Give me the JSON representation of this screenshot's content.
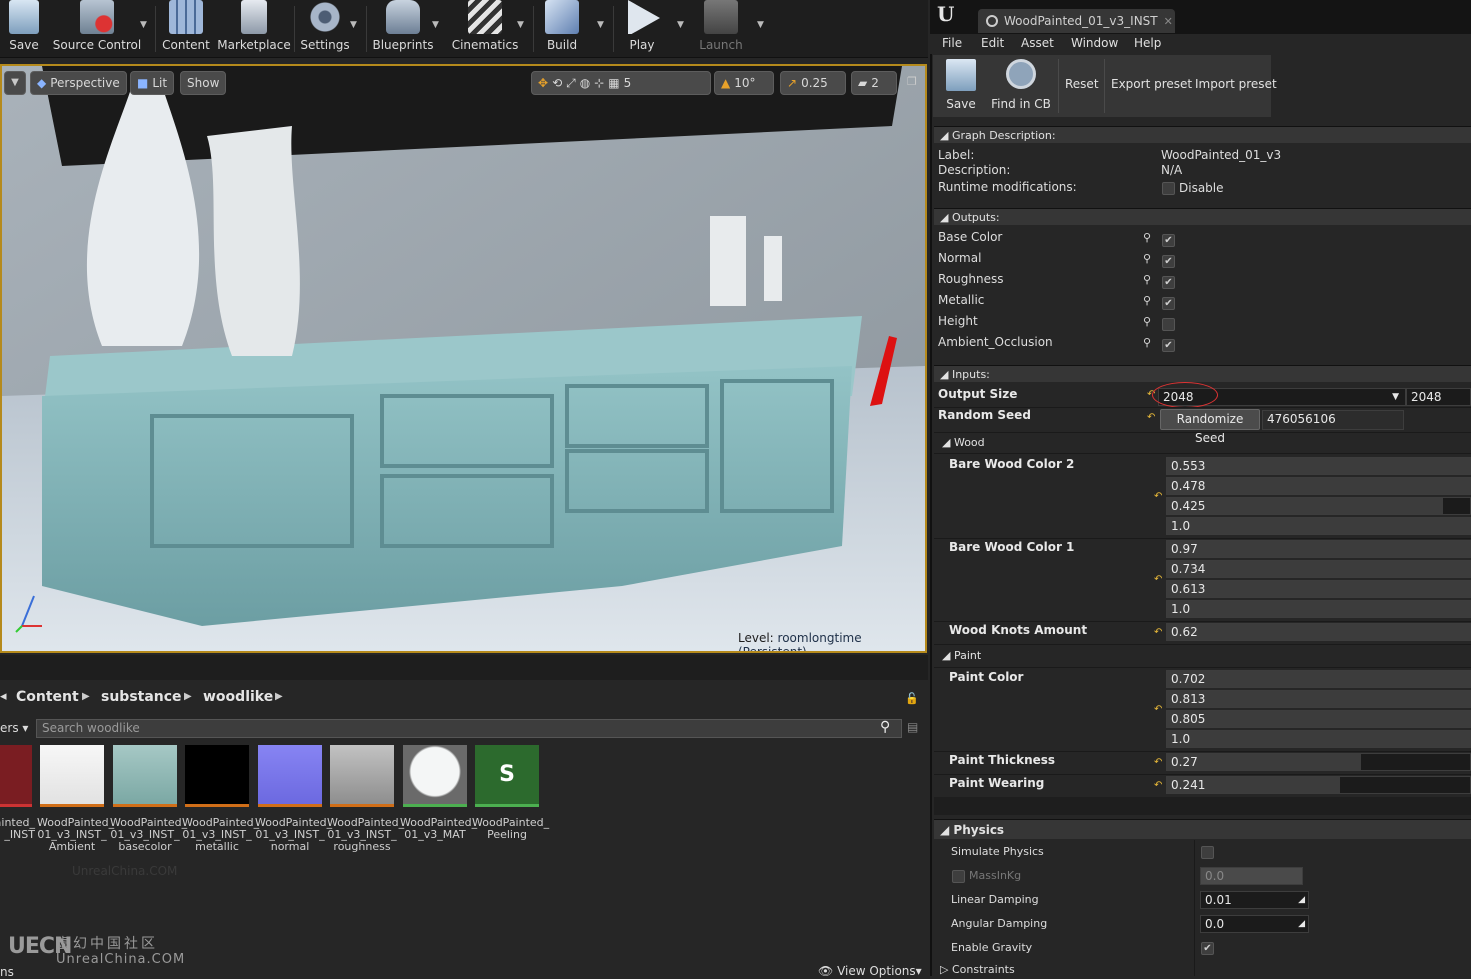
{
  "toolbar": {
    "buttons": [
      {
        "label": "Save",
        "icon": "save-icon"
      },
      {
        "label": "Source Control",
        "icon": "source-control-icon"
      },
      {
        "label": "Content",
        "icon": "content-icon"
      },
      {
        "label": "Marketplace",
        "icon": "marketplace-icon"
      },
      {
        "label": "Settings",
        "icon": "settings-icon"
      },
      {
        "label": "Blueprints",
        "icon": "blueprints-icon"
      },
      {
        "label": "Cinematics",
        "icon": "cinematics-icon"
      },
      {
        "label": "Build",
        "icon": "build-icon"
      },
      {
        "label": "Play",
        "icon": "play-icon"
      },
      {
        "label": "Launch",
        "icon": "launch-icon"
      }
    ]
  },
  "viewport": {
    "perspective": "Perspective",
    "lit": "Lit",
    "show": "Show",
    "grid_snap": "5",
    "rotation_snap": "10°",
    "scale_snap": "0.25",
    "camera_speed": "2",
    "level_label": "Level:",
    "level_name": "roomlongtime (Persistent)"
  },
  "content_browser": {
    "breadcrumb": [
      "Content",
      "substance",
      "woodlike"
    ],
    "filters_label": "ers",
    "search_placeholder": "Search woodlike",
    "assets": [
      {
        "name": "ainted_\n_INST",
        "color": "#7a1d22"
      },
      {
        "name": "WoodPainted_\n01_v3_INST_\nAmbient",
        "color": "#f2f2f2"
      },
      {
        "name": "WoodPainted_\n01_v3_INST_\nbasecolor",
        "color": "#8fb8b4"
      },
      {
        "name": "WoodPainted_\n01_v3_INST_\nmetallic",
        "color": "#000000"
      },
      {
        "name": "WoodPainted_\n01_v3_INST_\nnormal",
        "color": "#7b78ec"
      },
      {
        "name": "WoodPainted_\n01_v3_INST_\nroughness",
        "color": "#a9a9a9"
      },
      {
        "name": "WoodPainted_\n01_v3_MAT",
        "color": "#dfe3e3"
      },
      {
        "name": "WoodPainted_\nPeeling",
        "color": "#2c6a2d"
      }
    ],
    "watermark_small": "UnrealChina.COM",
    "logo_text": "UECN",
    "logo_cn": "虚幻中国社区",
    "logo_url": "UnrealChina.COM",
    "view_options": "View Options",
    "left_stub": "ns"
  },
  "editor": {
    "logo": "U",
    "tab_title": "WoodPainted_01_v3_INST",
    "menu": [
      "File",
      "Edit",
      "Asset",
      "Window",
      "Help"
    ],
    "tool": {
      "save": "Save",
      "find": "Find in CB",
      "reset": "Reset",
      "export": "Export preset",
      "import": "Import preset"
    },
    "graph_description": {
      "header": "Graph Description:",
      "label_k": "Label:",
      "label_v": "WoodPainted_01_v3",
      "desc_k": "Description:",
      "desc_v": "N/A",
      "runtime_k": "Runtime modifications:",
      "runtime_v": "Disable"
    },
    "outputs_header": "Outputs:",
    "outputs": [
      {
        "name": "Base Color",
        "checked": true
      },
      {
        "name": "Normal",
        "checked": true
      },
      {
        "name": "Roughness",
        "checked": true
      },
      {
        "name": "Metallic",
        "checked": true
      },
      {
        "name": "Height",
        "checked": false
      },
      {
        "name": "Ambient_Occlusion",
        "checked": true
      }
    ],
    "inputs_header": "Inputs:",
    "output_size_label": "Output Size",
    "output_size_value": "2048",
    "output_size_value2": "2048",
    "random_seed_label": "Random Seed",
    "randomize_button": "Randomize Seed",
    "random_seed_value": "476056106",
    "wood_header": "Wood",
    "bare_wood_color2_label": "Bare Wood Color 2",
    "bare_wood_color2": [
      "0.553",
      "0.478",
      "0.425",
      "1.0"
    ],
    "bare_wood_color1_label": "Bare Wood Color 1",
    "bare_wood_color1": [
      "0.97",
      "0.734",
      "0.613",
      "1.0"
    ],
    "wood_knots_label": "Wood Knots Amount",
    "wood_knots_value": "0.62",
    "paint_header": "Paint",
    "paint_color_label": "Paint Color",
    "paint_color": [
      "0.702",
      "0.813",
      "0.805",
      "1.0"
    ],
    "paint_thickness_label": "Paint Thickness",
    "paint_thickness_value": "0.27",
    "paint_wearing_label": "Paint Wearing",
    "paint_wearing_value": "0.241",
    "physics_header": "Physics",
    "simulate_physics": "Simulate Physics",
    "mass_label": "MassInKg",
    "mass_value": "0.0",
    "linear_damping_label": "Linear Damping",
    "linear_damping_value": "0.01",
    "angular_damping_label": "Angular Damping",
    "angular_damping_value": "0.0",
    "enable_gravity_label": "Enable Gravity",
    "constraints_label": "Constraints"
  }
}
